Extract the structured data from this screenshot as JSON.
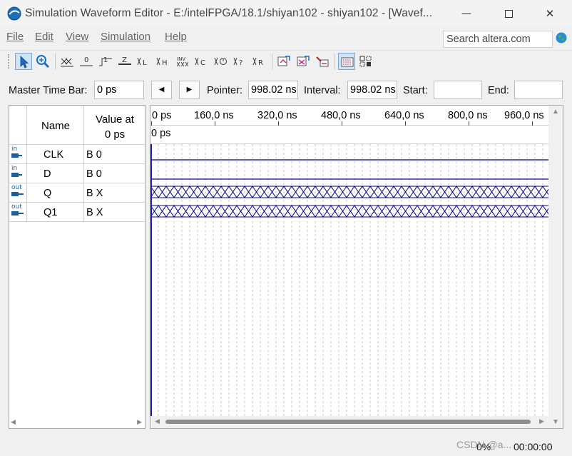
{
  "window": {
    "title": "Simulation Waveform Editor - E:/intelFPGA/18.1/shiyan102 - shiyan102 - [Wavef...",
    "minimize": "—",
    "close": "✕"
  },
  "menu": {
    "items": [
      "File",
      "Edit",
      "View",
      "Simulation",
      "Help"
    ],
    "search_placeholder": "Search altera.com"
  },
  "toolbar": {
    "tools": [
      "selection-tool",
      "zoom-tool",
      "force-unknown",
      "force-low",
      "force-high",
      "force-high-impedance",
      "force-weak-low",
      "force-weak-high",
      "invert",
      "count-value",
      "clock",
      "arbitrary-value",
      "random-value",
      "snap-to-grid",
      "sort",
      "waveform-compare",
      "overwrite-clock",
      "overwrite-random"
    ]
  },
  "time_controls": {
    "master_time_bar_label": "Master Time Bar:",
    "master_time_bar_value": "0 ps",
    "prev_button": "◀",
    "next_button": "▶",
    "pointer_label": "Pointer:",
    "pointer_value": "998.02 ns",
    "interval_label": "Interval:",
    "interval_value": "998.02 ns",
    "start_label": "Start:",
    "start_value": "",
    "end_label": "End:",
    "end_value": ""
  },
  "signal_table": {
    "name_header": "Name",
    "value_header_line1": "Value at",
    "value_header_line2": "0 ps",
    "rows": [
      {
        "direction": "in",
        "name": "CLK",
        "value": "B 0",
        "waveform": "low"
      },
      {
        "direction": "in",
        "name": "D",
        "value": "B 0",
        "waveform": "low"
      },
      {
        "direction": "out",
        "name": "Q",
        "value": "B X",
        "waveform": "unknown"
      },
      {
        "direction": "out",
        "name": "Q1",
        "value": "B X",
        "waveform": "unknown"
      }
    ]
  },
  "waveform": {
    "tick_labels": [
      "0 ps",
      "160,0 ns",
      "320,0 ns",
      "480,0 ns",
      "640,0 ns",
      "800,0 ns",
      "960,0 ns"
    ],
    "cursor_label": "0 ps",
    "cursor_color": "#1f1fb0",
    "wave_color": "#000080",
    "grid_color": "#c8c8c8"
  },
  "status": {
    "progress": "0%",
    "elapsed": "00:00:00"
  },
  "watermark": "CSDN @a...",
  "scroll": {
    "left": "◀",
    "right": "▶",
    "up": "▲",
    "down": "▼"
  }
}
